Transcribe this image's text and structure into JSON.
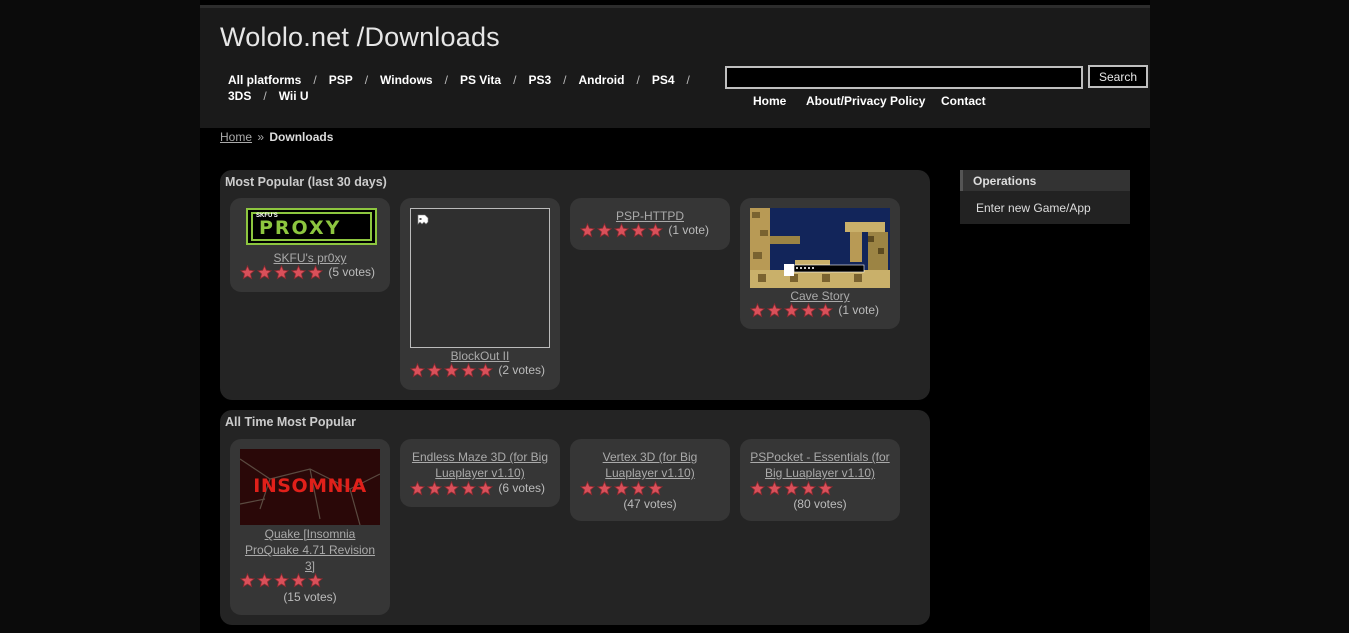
{
  "site": {
    "title": "Wololo.net /Downloads"
  },
  "platforms": [
    "All platforms",
    "PSP",
    "Windows",
    "PS Vita",
    "PS3",
    "Android",
    "PS4",
    "3DS",
    "Wii U"
  ],
  "platform_separator": "/",
  "search": {
    "button_label": "Search",
    "value": "",
    "placeholder": ""
  },
  "topnav": [
    "Home",
    "About/Privacy Policy",
    "Contact"
  ],
  "breadcrumb": {
    "home": "Home",
    "separator": "»",
    "current": "Downloads"
  },
  "sections": {
    "recent": {
      "title": "Most Popular (last 30 days)",
      "items": [
        {
          "name": "SKFU's pr0xy",
          "rating": 5,
          "votes": "(5 votes)",
          "image_text": "PROXY",
          "image_small": "SKFU'S"
        },
        {
          "name": "BlockOut II",
          "rating": 5,
          "votes": "(2 votes)"
        },
        {
          "name": "PSP-HTTPD",
          "rating": 5,
          "votes": "(1 vote)"
        },
        {
          "name": "Cave Story",
          "rating": 5,
          "votes": "(1 vote)"
        }
      ]
    },
    "alltime": {
      "title": "All Time Most Popular",
      "items": [
        {
          "name": "Quake [Insomnia ProQuake 4.71 Revision 3]",
          "rating": 5,
          "votes": "(15 votes)",
          "image_text": "INSOMNIA"
        },
        {
          "name": "Endless Maze 3D (for Big Luaplayer v1.10)",
          "rating": 5,
          "votes": "(6 votes)"
        },
        {
          "name": "Vertex 3D (for Big Luaplayer v1.10)",
          "rating": 5,
          "votes": "(47 votes)"
        },
        {
          "name": "PSPocket - Essentials (for Big Luaplayer v1.10)",
          "rating": 5,
          "votes": "(80 votes)"
        }
      ]
    }
  },
  "sidebar": {
    "title": "Operations",
    "link": "Enter new Game/App"
  },
  "colors": {
    "star_fill": "#d9505a",
    "star_stroke": "#8a2a30",
    "proxy_green": "#8dc63f"
  },
  "icons": {
    "rating": "star-icon",
    "broken_image": "broken-image-icon"
  }
}
